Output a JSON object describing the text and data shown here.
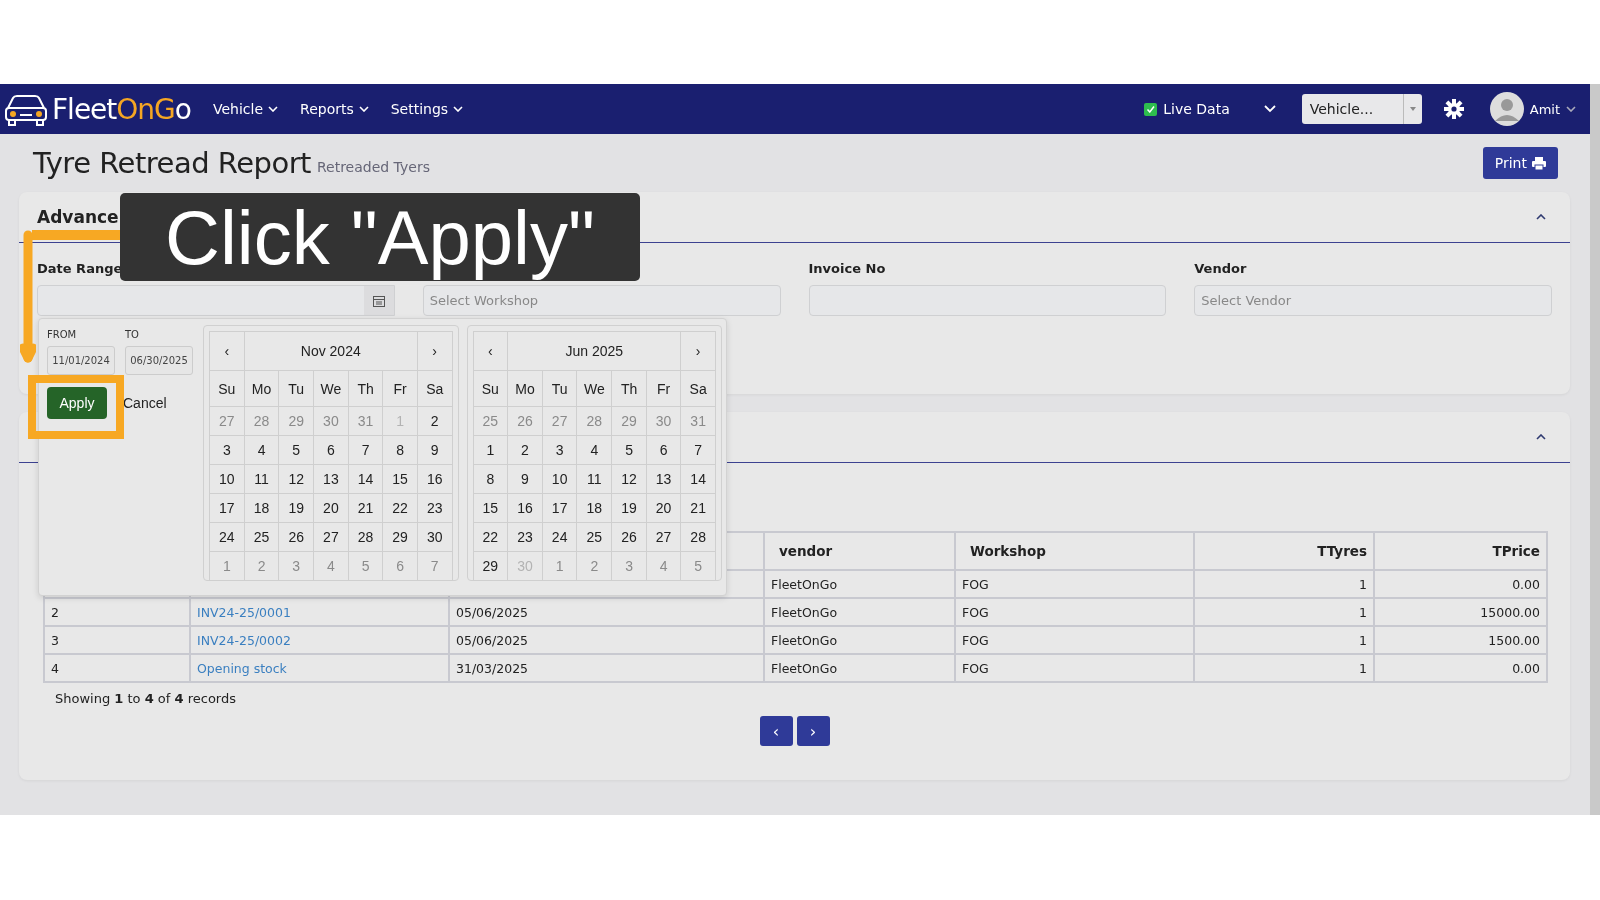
{
  "navbar": {
    "logo": [
      {
        "text": "Fleet",
        "accent": false
      },
      {
        "text": "OnG",
        "accent": true
      },
      {
        "text": "o",
        "accent": false
      }
    ],
    "menu": [
      "Vehicle",
      "Reports",
      "Settings"
    ],
    "live_data": {
      "label": "Live Data",
      "checked": true
    },
    "vehicle_select": {
      "value": "Vehicle..."
    },
    "user": "Amit"
  },
  "page": {
    "title": "Tyre Retread Report",
    "subtitle": "Retreaded Tyers",
    "print_button": "Print"
  },
  "search_card": {
    "title": "Advance",
    "date_label": "Date Range",
    "workshop_placeholder": "Select Workshop",
    "invoice_label": "Invoice No",
    "vendor_label": "Vendor",
    "vendor_placeholder": "Select Vendor"
  },
  "date_picker": {
    "from_label": "FROM",
    "from": "11/01/2024",
    "to_label": "TO",
    "to": "06/30/2025",
    "apply": "Apply",
    "cancel": "Cancel",
    "months": [
      {
        "title": "Nov 2024",
        "prev": "‹",
        "next": "›",
        "weekdays": [
          "Su",
          "Mo",
          "Tu",
          "We",
          "Th",
          "Fr",
          "Sa"
        ],
        "days": [
          {
            "day": "27",
            "kind": "other"
          },
          {
            "day": "28",
            "kind": "other"
          },
          {
            "day": "29",
            "kind": "other"
          },
          {
            "day": "30",
            "kind": "other"
          },
          {
            "day": "31",
            "kind": "other"
          },
          {
            "day": "1",
            "kind": "disabled"
          },
          {
            "day": "2",
            "kind": "normal"
          },
          {
            "day": "3",
            "kind": "normal"
          },
          {
            "day": "4",
            "kind": "normal"
          },
          {
            "day": "5",
            "kind": "normal"
          },
          {
            "day": "6",
            "kind": "normal"
          },
          {
            "day": "7",
            "kind": "normal"
          },
          {
            "day": "8",
            "kind": "normal"
          },
          {
            "day": "9",
            "kind": "normal"
          },
          {
            "day": "10",
            "kind": "normal"
          },
          {
            "day": "11",
            "kind": "normal"
          },
          {
            "day": "12",
            "kind": "normal"
          },
          {
            "day": "13",
            "kind": "normal"
          },
          {
            "day": "14",
            "kind": "normal"
          },
          {
            "day": "15",
            "kind": "normal"
          },
          {
            "day": "16",
            "kind": "normal"
          },
          {
            "day": "17",
            "kind": "normal"
          },
          {
            "day": "18",
            "kind": "normal"
          },
          {
            "day": "19",
            "kind": "normal"
          },
          {
            "day": "20",
            "kind": "normal"
          },
          {
            "day": "21",
            "kind": "normal"
          },
          {
            "day": "22",
            "kind": "normal"
          },
          {
            "day": "23",
            "kind": "normal"
          },
          {
            "day": "24",
            "kind": "normal"
          },
          {
            "day": "25",
            "kind": "normal"
          },
          {
            "day": "26",
            "kind": "normal"
          },
          {
            "day": "27",
            "kind": "normal"
          },
          {
            "day": "28",
            "kind": "normal"
          },
          {
            "day": "29",
            "kind": "normal"
          },
          {
            "day": "30",
            "kind": "normal"
          },
          {
            "day": "1",
            "kind": "other"
          },
          {
            "day": "2",
            "kind": "other"
          },
          {
            "day": "3",
            "kind": "other"
          },
          {
            "day": "4",
            "kind": "other"
          },
          {
            "day": "5",
            "kind": "other"
          },
          {
            "day": "6",
            "kind": "other"
          },
          {
            "day": "7",
            "kind": "other"
          }
        ]
      },
      {
        "title": "Jun 2025",
        "prev": "‹",
        "next": "›",
        "weekdays": [
          "Su",
          "Mo",
          "Tu",
          "We",
          "Th",
          "Fr",
          "Sa"
        ],
        "days": [
          {
            "day": "25",
            "kind": "other"
          },
          {
            "day": "26",
            "kind": "other"
          },
          {
            "day": "27",
            "kind": "other"
          },
          {
            "day": "28",
            "kind": "other"
          },
          {
            "day": "29",
            "kind": "other"
          },
          {
            "day": "30",
            "kind": "other"
          },
          {
            "day": "31",
            "kind": "other"
          },
          {
            "day": "1",
            "kind": "normal"
          },
          {
            "day": "2",
            "kind": "normal"
          },
          {
            "day": "3",
            "kind": "normal"
          },
          {
            "day": "4",
            "kind": "normal"
          },
          {
            "day": "5",
            "kind": "normal"
          },
          {
            "day": "6",
            "kind": "normal"
          },
          {
            "day": "7",
            "kind": "normal"
          },
          {
            "day": "8",
            "kind": "normal"
          },
          {
            "day": "9",
            "kind": "normal"
          },
          {
            "day": "10",
            "kind": "normal"
          },
          {
            "day": "11",
            "kind": "normal"
          },
          {
            "day": "12",
            "kind": "normal"
          },
          {
            "day": "13",
            "kind": "normal"
          },
          {
            "day": "14",
            "kind": "normal"
          },
          {
            "day": "15",
            "kind": "normal"
          },
          {
            "day": "16",
            "kind": "normal"
          },
          {
            "day": "17",
            "kind": "normal"
          },
          {
            "day": "18",
            "kind": "normal"
          },
          {
            "day": "19",
            "kind": "normal"
          },
          {
            "day": "20",
            "kind": "normal"
          },
          {
            "day": "21",
            "kind": "normal"
          },
          {
            "day": "22",
            "kind": "normal"
          },
          {
            "day": "23",
            "kind": "normal"
          },
          {
            "day": "24",
            "kind": "normal"
          },
          {
            "day": "25",
            "kind": "normal"
          },
          {
            "day": "26",
            "kind": "normal"
          },
          {
            "day": "27",
            "kind": "normal"
          },
          {
            "day": "28",
            "kind": "normal"
          },
          {
            "day": "29",
            "kind": "normal"
          },
          {
            "day": "30",
            "kind": "disabled"
          },
          {
            "day": "1",
            "kind": "other"
          },
          {
            "day": "2",
            "kind": "other"
          },
          {
            "day": "3",
            "kind": "other"
          },
          {
            "day": "4",
            "kind": "other"
          },
          {
            "day": "5",
            "kind": "other"
          }
        ]
      }
    ]
  },
  "table": {
    "columns": [
      "vendor",
      "Workshop",
      "TTyres",
      "TPrice"
    ],
    "rows": [
      {
        "vendor": "FleetOnGo",
        "workshop": "FOG",
        "tyres": "1",
        "price": "0.00"
      },
      {
        "number": "2",
        "invoice": "INV24-25/0001",
        "date": "05/06/2025",
        "vendor": "FleetOnGo",
        "workshop": "FOG",
        "tyres": "1",
        "price": "15000.00"
      },
      {
        "number": "3",
        "invoice": "INV24-25/0002",
        "date": "05/06/2025",
        "vendor": "FleetOnGo",
        "workshop": "FOG",
        "tyres": "1",
        "price": "1500.00"
      },
      {
        "number": "4",
        "invoice": "Opening stock",
        "date": "31/03/2025",
        "vendor": "FleetOnGo",
        "workshop": "FOG",
        "tyres": "1",
        "price": "0.00"
      }
    ],
    "summary": "Showing **1** to **4** of **4** records",
    "prev": "‹",
    "next": "›"
  },
  "callout": {
    "text": "Click \"Apply\""
  }
}
